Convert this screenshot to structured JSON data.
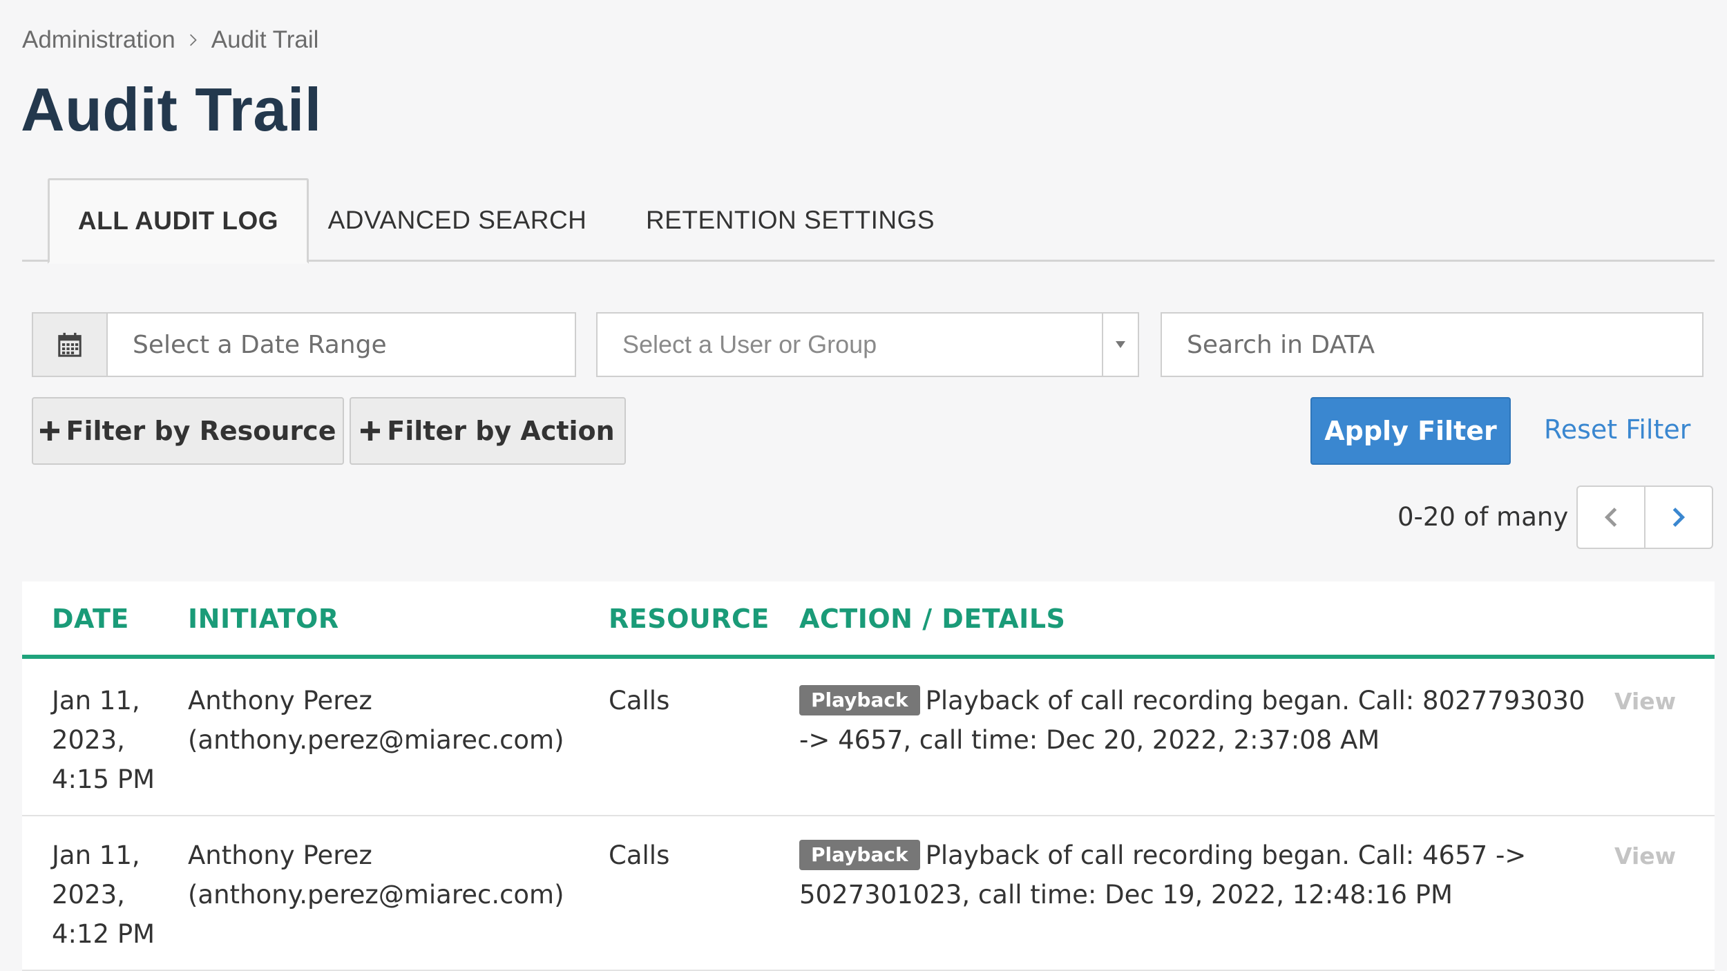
{
  "breadcrumb": {
    "parent": "Administration",
    "current": "Audit Trail"
  },
  "page_title": "Audit Trail",
  "tabs": [
    {
      "label": "ALL AUDIT LOG",
      "active": true
    },
    {
      "label": "ADVANCED SEARCH",
      "active": false
    },
    {
      "label": "RETENTION SETTINGS",
      "active": false
    }
  ],
  "filters": {
    "date_range": {
      "placeholder": "Select a Date Range",
      "value": ""
    },
    "user_group": {
      "placeholder": "Select a User or Group",
      "value": ""
    },
    "search_data": {
      "placeholder": "Search in DATA",
      "value": ""
    },
    "filter_resource_label": "Filter by Resource",
    "filter_action_label": "Filter by Action",
    "apply_label": "Apply Filter",
    "reset_label": "Reset Filter"
  },
  "pagination": {
    "text": "0-20 of many"
  },
  "table": {
    "columns": [
      "DATE",
      "INITIATOR",
      "RESOURCE",
      "ACTION / DETAILS"
    ],
    "rows": [
      {
        "date": "Jan 11, 2023, 4:15 PM",
        "initiator": "Anthony Perez (anthony.perez@miarec.com)",
        "resource": "Calls",
        "badge": "Playback",
        "details": "Playback of call recording began. Call: 8027793030 -> 4657, call time: Dec 20, 2022, 2:37:08 AM",
        "view": "View"
      },
      {
        "date": "Jan 11, 2023, 4:12 PM",
        "initiator": "Anthony Perez (anthony.perez@miarec.com)",
        "resource": "Calls",
        "badge": "Playback",
        "details": "Playback of call recording began. Call: 4657 -> 5027301023, call time: Dec 19, 2022, 12:48:16 PM",
        "view": "View"
      }
    ]
  },
  "icons": {
    "calendar": "calendar-icon",
    "breadcrumb_sep": "chevron-right-icon",
    "dropdown": "caret-down-icon",
    "plus": "plus-icon",
    "prev": "chevron-left-icon",
    "next": "chevron-right-icon"
  },
  "colors": {
    "title": "#23384d",
    "accent_green": "#1a9b78",
    "primary_blue": "#3a87d0",
    "badge_gray": "#777777"
  }
}
